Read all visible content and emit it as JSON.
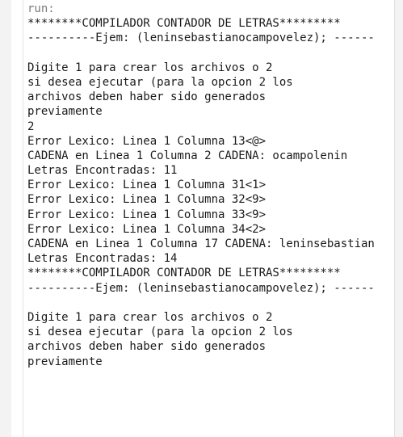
{
  "console": {
    "lines": [
      "run:",
      "********COMPILADOR CONTADOR DE LETRAS*********",
      "----------Ejem: (leninsebastianocampovelez); ------",
      "",
      "Digite 1 para crear los archivos o 2",
      "si desea ejecutar (para la opcion 2 los",
      "archivos deben haber sido generados",
      "previamente",
      "2",
      "Error Lexico: Linea 1 Columna 13<@>",
      "CADENA en Linea 1 Columna 2 CADENA: ocampolenin",
      "Letras Encontradas: 11",
      "Error Lexico: Linea 1 Columna 31<1>",
      "Error Lexico: Linea 1 Columna 32<9>",
      "Error Lexico: Linea 1 Columna 33<9>",
      "Error Lexico: Linea 1 Columna 34<2>",
      "CADENA en Linea 1 Columna 17 CADENA: leninsebastian",
      "Letras Encontradas: 14",
      "********COMPILADOR CONTADOR DE LETRAS*********",
      "----------Ejem: (leninsebastianocampovelez); ------",
      "",
      "Digite 1 para crear los archivos o 2",
      "si desea ejecutar (para la opcion 2 los",
      "archivos deben haber sido generados",
      "previamente"
    ]
  }
}
